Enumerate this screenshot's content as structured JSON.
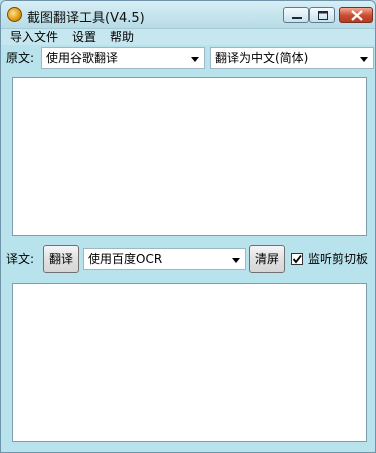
{
  "window": {
    "title": "截图翻译工具(V4.5)"
  },
  "menu": [
    "导入文件",
    "设置",
    "帮助"
  ],
  "source": {
    "label": "原文:",
    "engine": "使用谷歌翻译",
    "target": "翻译为中文(简体)",
    "text": ""
  },
  "result": {
    "label": "译文:",
    "translate_button": "翻译",
    "ocr_engine": "使用百度OCR",
    "clear_button": "清屏",
    "monitor_clipboard": "监听剪切板",
    "monitor_checked": true,
    "text": ""
  }
}
